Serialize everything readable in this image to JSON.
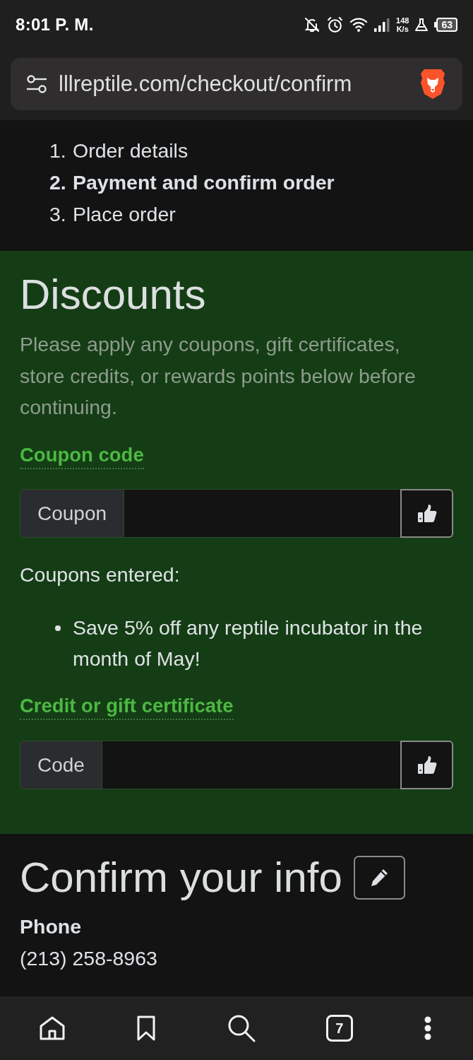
{
  "status_bar": {
    "time": "8:01 P. M.",
    "network_speed": "148",
    "network_speed_unit": "K/s",
    "battery": "63"
  },
  "address_bar": {
    "url": "lllreptile.com/checkout/confirm"
  },
  "checkout_steps": [
    {
      "number": "1.",
      "label": "Order details",
      "selected": false
    },
    {
      "number": "2.",
      "label": "Payment and confirm order",
      "selected": true
    },
    {
      "number": "3.",
      "label": "Place order",
      "selected": false
    }
  ],
  "discounts": {
    "title": "Discounts",
    "description": "Please apply any coupons, gift certificates, store credits, or rewards points below before continuing.",
    "coupon": {
      "label": "Coupon code",
      "prefix": "Coupon"
    },
    "coupons_entered": {
      "label": "Coupons entered:",
      "items": [
        "Save 5% off any reptile incubator in the month of May!"
      ]
    },
    "gift_certificate": {
      "label": "Credit or gift certificate",
      "prefix": "Code"
    }
  },
  "confirm_info": {
    "title": "Confirm your info",
    "fields": [
      {
        "label": "Phone",
        "value": "(213) 258-8963"
      }
    ]
  },
  "bottom_bar": {
    "tab_count": "7"
  }
}
